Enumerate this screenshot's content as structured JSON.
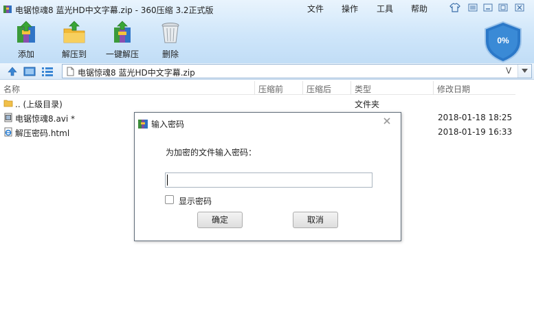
{
  "window": {
    "title": "电锯惊魂8 蓝光HD中文字幕.zip - 360压缩 3.2正式版"
  },
  "menu": {
    "items": [
      "文件",
      "操作",
      "工具",
      "帮助"
    ]
  },
  "toolbar": {
    "add": "添加",
    "extract_to": "解压到",
    "one_click_extract": "一键解压",
    "delete": "删除"
  },
  "security": {
    "percent": "0%"
  },
  "address": {
    "path": "电锯惊魂8 蓝光HD中文字幕.zip",
    "filter_label": "V"
  },
  "columns": {
    "name": "名称",
    "before": "压缩前",
    "after": "压缩后",
    "type": "类型",
    "modified": "修改日期"
  },
  "files": [
    {
      "name": ".. (上级目录)",
      "type": "文件夹",
      "modified": ""
    },
    {
      "name": "电锯惊魂8.avi *",
      "type": "",
      "modified": "2018-01-18 18:25"
    },
    {
      "name": "解压密码.html",
      "type": "",
      "modified": "2018-01-19 16:33"
    }
  ],
  "dialog": {
    "title": "输入密码",
    "prompt": "为加密的文件输入密码：",
    "password_value": "",
    "show_password": "显示密码",
    "ok": "确定",
    "cancel": "取消"
  },
  "colors": {
    "accent": "#2e7bd1",
    "toolbar_bg": "#cfe6fa",
    "shield": "#2b78c8"
  }
}
